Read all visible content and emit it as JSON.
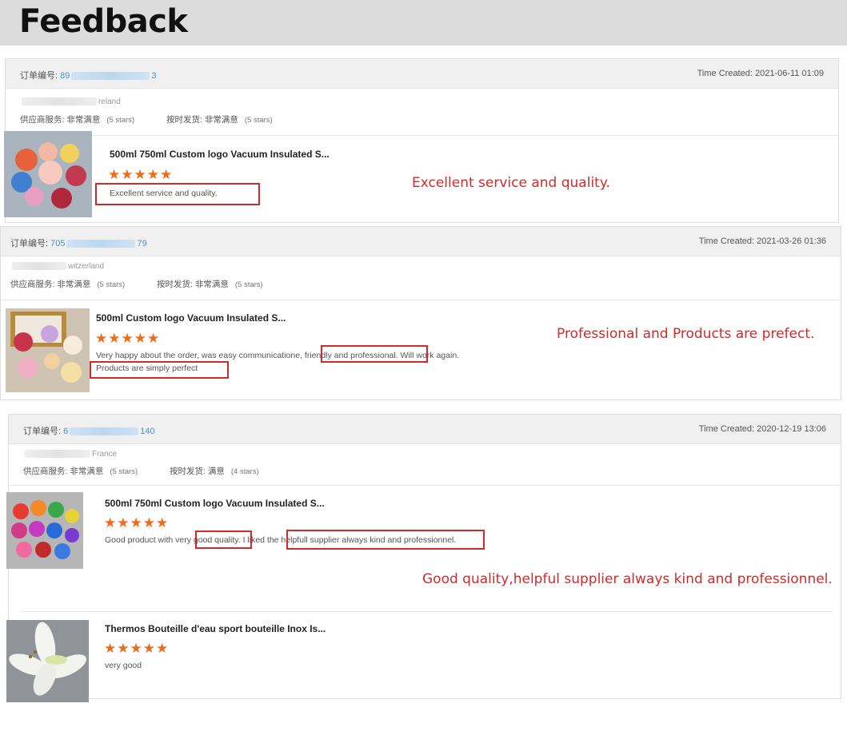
{
  "page_title": "Feedback",
  "colors": {
    "accent_red": "#d22a2a",
    "star": "#f06a18",
    "order_link": "#4a90c8"
  },
  "icons": [
    "star-icon",
    "product-thumbnail"
  ],
  "reviews": [
    {
      "order_label": "订单编号:",
      "order_prefix": "89",
      "order_suffix": "3",
      "time_created": "Time Created: 2021-06-11 01:09",
      "country": "reland",
      "service_label": "供应商服务: 非常满意",
      "service_stars": "(5 stars)",
      "shipping_label": "按时发货: 非常满意",
      "shipping_stars": "(5 stars)",
      "product_title": "500ml 750ml Custom logo Vacuum Insulated S...",
      "stars": "★★★★★",
      "review_text": "Excellent service and quality.",
      "annotation": "Excellent service and quality."
    },
    {
      "order_label": "订单编号:",
      "order_prefix": "705",
      "order_suffix": "79",
      "time_created": "Time Created: 2021-03-26 01:36",
      "country": "witzerland",
      "service_label": "供应商服务: 非常满意",
      "service_stars": "(5 stars)",
      "shipping_label": "按时发货: 非常满意",
      "shipping_stars": "(5 stars)",
      "product_title": "500ml Custom logo Vacuum Insulated S...",
      "stars": "★★★★★",
      "review_line1": "Very happy about the order, was easy communicatione, friendly and professional. Will work again.",
      "review_line2": "Products are simply perfect",
      "annotation": "Professional and Products are prefect."
    },
    {
      "order_label": "订单编号:",
      "order_prefix": "6",
      "order_suffix": "140",
      "time_created": "Time Created: 2020-12-19 13:06",
      "country": "France",
      "service_label": "供应商服务: 非常满意",
      "service_stars": "(5 stars)",
      "shipping_label": "按时发货: 满意",
      "shipping_stars": "(4 stars)",
      "product_title": "500ml 750ml Custom logo Vacuum Insulated S...",
      "stars": "★★★★★",
      "review_text": "Good product with very good quality. I liked the helpfull supplier always kind and professionnel.",
      "annotation": "Good quality,helpful supplier always kind and professionnel.",
      "second_item": {
        "product_title": "Thermos Bouteille d'eau sport bouteille Inox Is...",
        "stars": "★★★★★",
        "review_text": "very good"
      }
    }
  ]
}
